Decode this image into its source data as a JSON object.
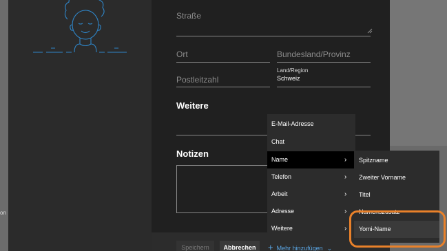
{
  "form": {
    "street_label": "Straße",
    "city_label": "Ort",
    "state_label": "Bundesland/Provinz",
    "postal_label": "Postleitzahl",
    "country_label": "Land/Region",
    "country_value": "Schweiz",
    "section_more": "Weitere",
    "section_notes": "Notizen"
  },
  "footer": {
    "save_label": "Speichern",
    "cancel_label": "Abbrechen",
    "add_more_label": "Mehr hinzufügen"
  },
  "menu": {
    "items": [
      {
        "label": "E-Mail-Adresse",
        "has_submenu": false
      },
      {
        "label": "Chat",
        "has_submenu": false
      },
      {
        "label": "Name",
        "has_submenu": true,
        "selected": true
      },
      {
        "label": "Telefon",
        "has_submenu": true
      },
      {
        "label": "Arbeit",
        "has_submenu": true
      },
      {
        "label": "Adresse",
        "has_submenu": true
      },
      {
        "label": "Weitere",
        "has_submenu": true
      }
    ]
  },
  "submenu": {
    "items": [
      {
        "label": "Spitzname"
      },
      {
        "label": "Zweiter Vorname"
      },
      {
        "label": "Titel"
      },
      {
        "label": "Namenszusatz"
      },
      {
        "label": "Yomi-Name",
        "selected": true
      }
    ]
  },
  "background": {
    "edge_label": "on"
  },
  "colors": {
    "accent_link": "#5aa7e6",
    "highlight": "#e9812a",
    "avatar_stroke": "#2f86c9"
  },
  "icons": [
    "avatar-illustration",
    "chevron-right-icon",
    "plus-icon",
    "chevron-down-icon",
    "resize-grip-icon"
  ]
}
